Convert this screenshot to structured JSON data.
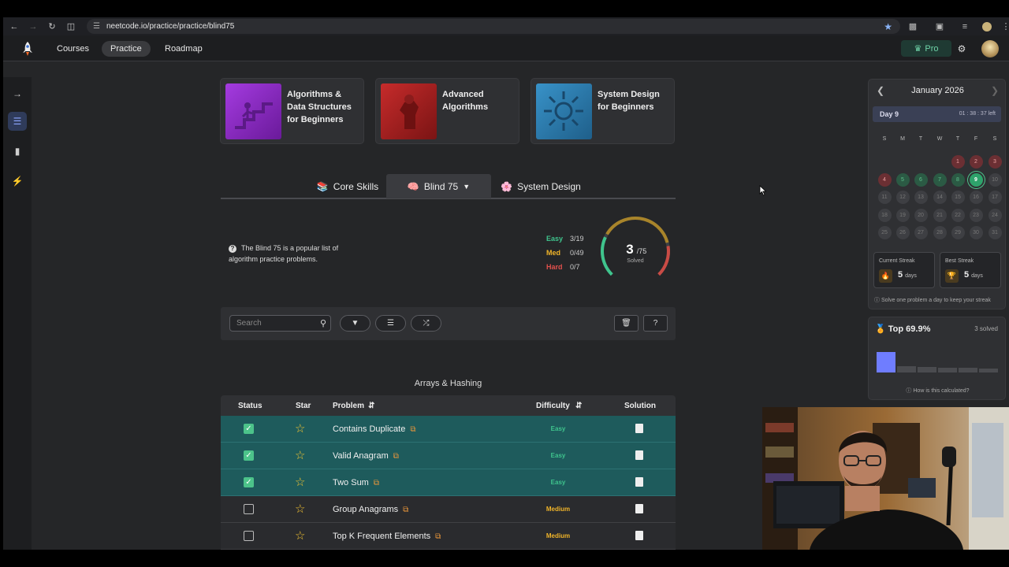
{
  "browser": {
    "url": "neetcode.io/practice/practice/blind75"
  },
  "nav": {
    "courses": "Courses",
    "practice": "Practice",
    "roadmap": "Roadmap",
    "pro": "Pro"
  },
  "courses": [
    {
      "title": "Algorithms & Data Structures for Beginners",
      "color": "#8a2fc4"
    },
    {
      "title": "Advanced Algorithms",
      "color": "#b52222"
    },
    {
      "title": "System Design for Beginners",
      "color": "#2d7fb0"
    }
  ],
  "tabs": {
    "core": "Core Skills",
    "blind": "Blind 75",
    "sysdesign": "System Design"
  },
  "info": {
    "text": "The Blind 75 is a popular list of algorithm practice problems."
  },
  "progress": {
    "easy_label": "Easy",
    "easy_count": "3/19",
    "med_label": "Med",
    "med_count": "0/49",
    "hard_label": "Hard",
    "hard_count": "0/7",
    "solved_num": "3",
    "solved_total": "/75",
    "solved_label": "Solved",
    "solved_fraction": 0.04
  },
  "toolbar": {
    "search_placeholder": "Search"
  },
  "section": {
    "title": "Arrays & Hashing"
  },
  "table": {
    "headers": {
      "status": "Status",
      "star": "Star",
      "problem": "Problem",
      "difficulty": "Difficulty",
      "solution": "Solution"
    },
    "rows": [
      {
        "name": "Contains Duplicate",
        "difficulty": "Easy",
        "solved": true
      },
      {
        "name": "Valid Anagram",
        "difficulty": "Easy",
        "solved": true
      },
      {
        "name": "Two Sum",
        "difficulty": "Easy",
        "solved": true
      },
      {
        "name": "Group Anagrams",
        "difficulty": "Medium",
        "solved": false
      },
      {
        "name": "Top K Frequent Elements",
        "difficulty": "Medium",
        "solved": false
      }
    ]
  },
  "calendar": {
    "month": "January 2026",
    "day_label": "Day 9",
    "time_left": "01 : 38 : 37 left",
    "weekdays": [
      "S",
      "M",
      "T",
      "W",
      "T",
      "F",
      "S"
    ],
    "current_streak_label": "Current Streak",
    "current_streak": "5",
    "best_streak_label": "Best Streak",
    "best_streak": "5",
    "days_unit": "days",
    "tip": "Solve one problem a day to keep your streak"
  },
  "rank": {
    "title": "Top 69.9%",
    "solved": "3 solved",
    "how": "How is this calculated?"
  },
  "colors": {
    "easy": "#3fc48d",
    "medium": "#f0b429",
    "hard": "#e2504c",
    "accent": "#4cc38a"
  }
}
